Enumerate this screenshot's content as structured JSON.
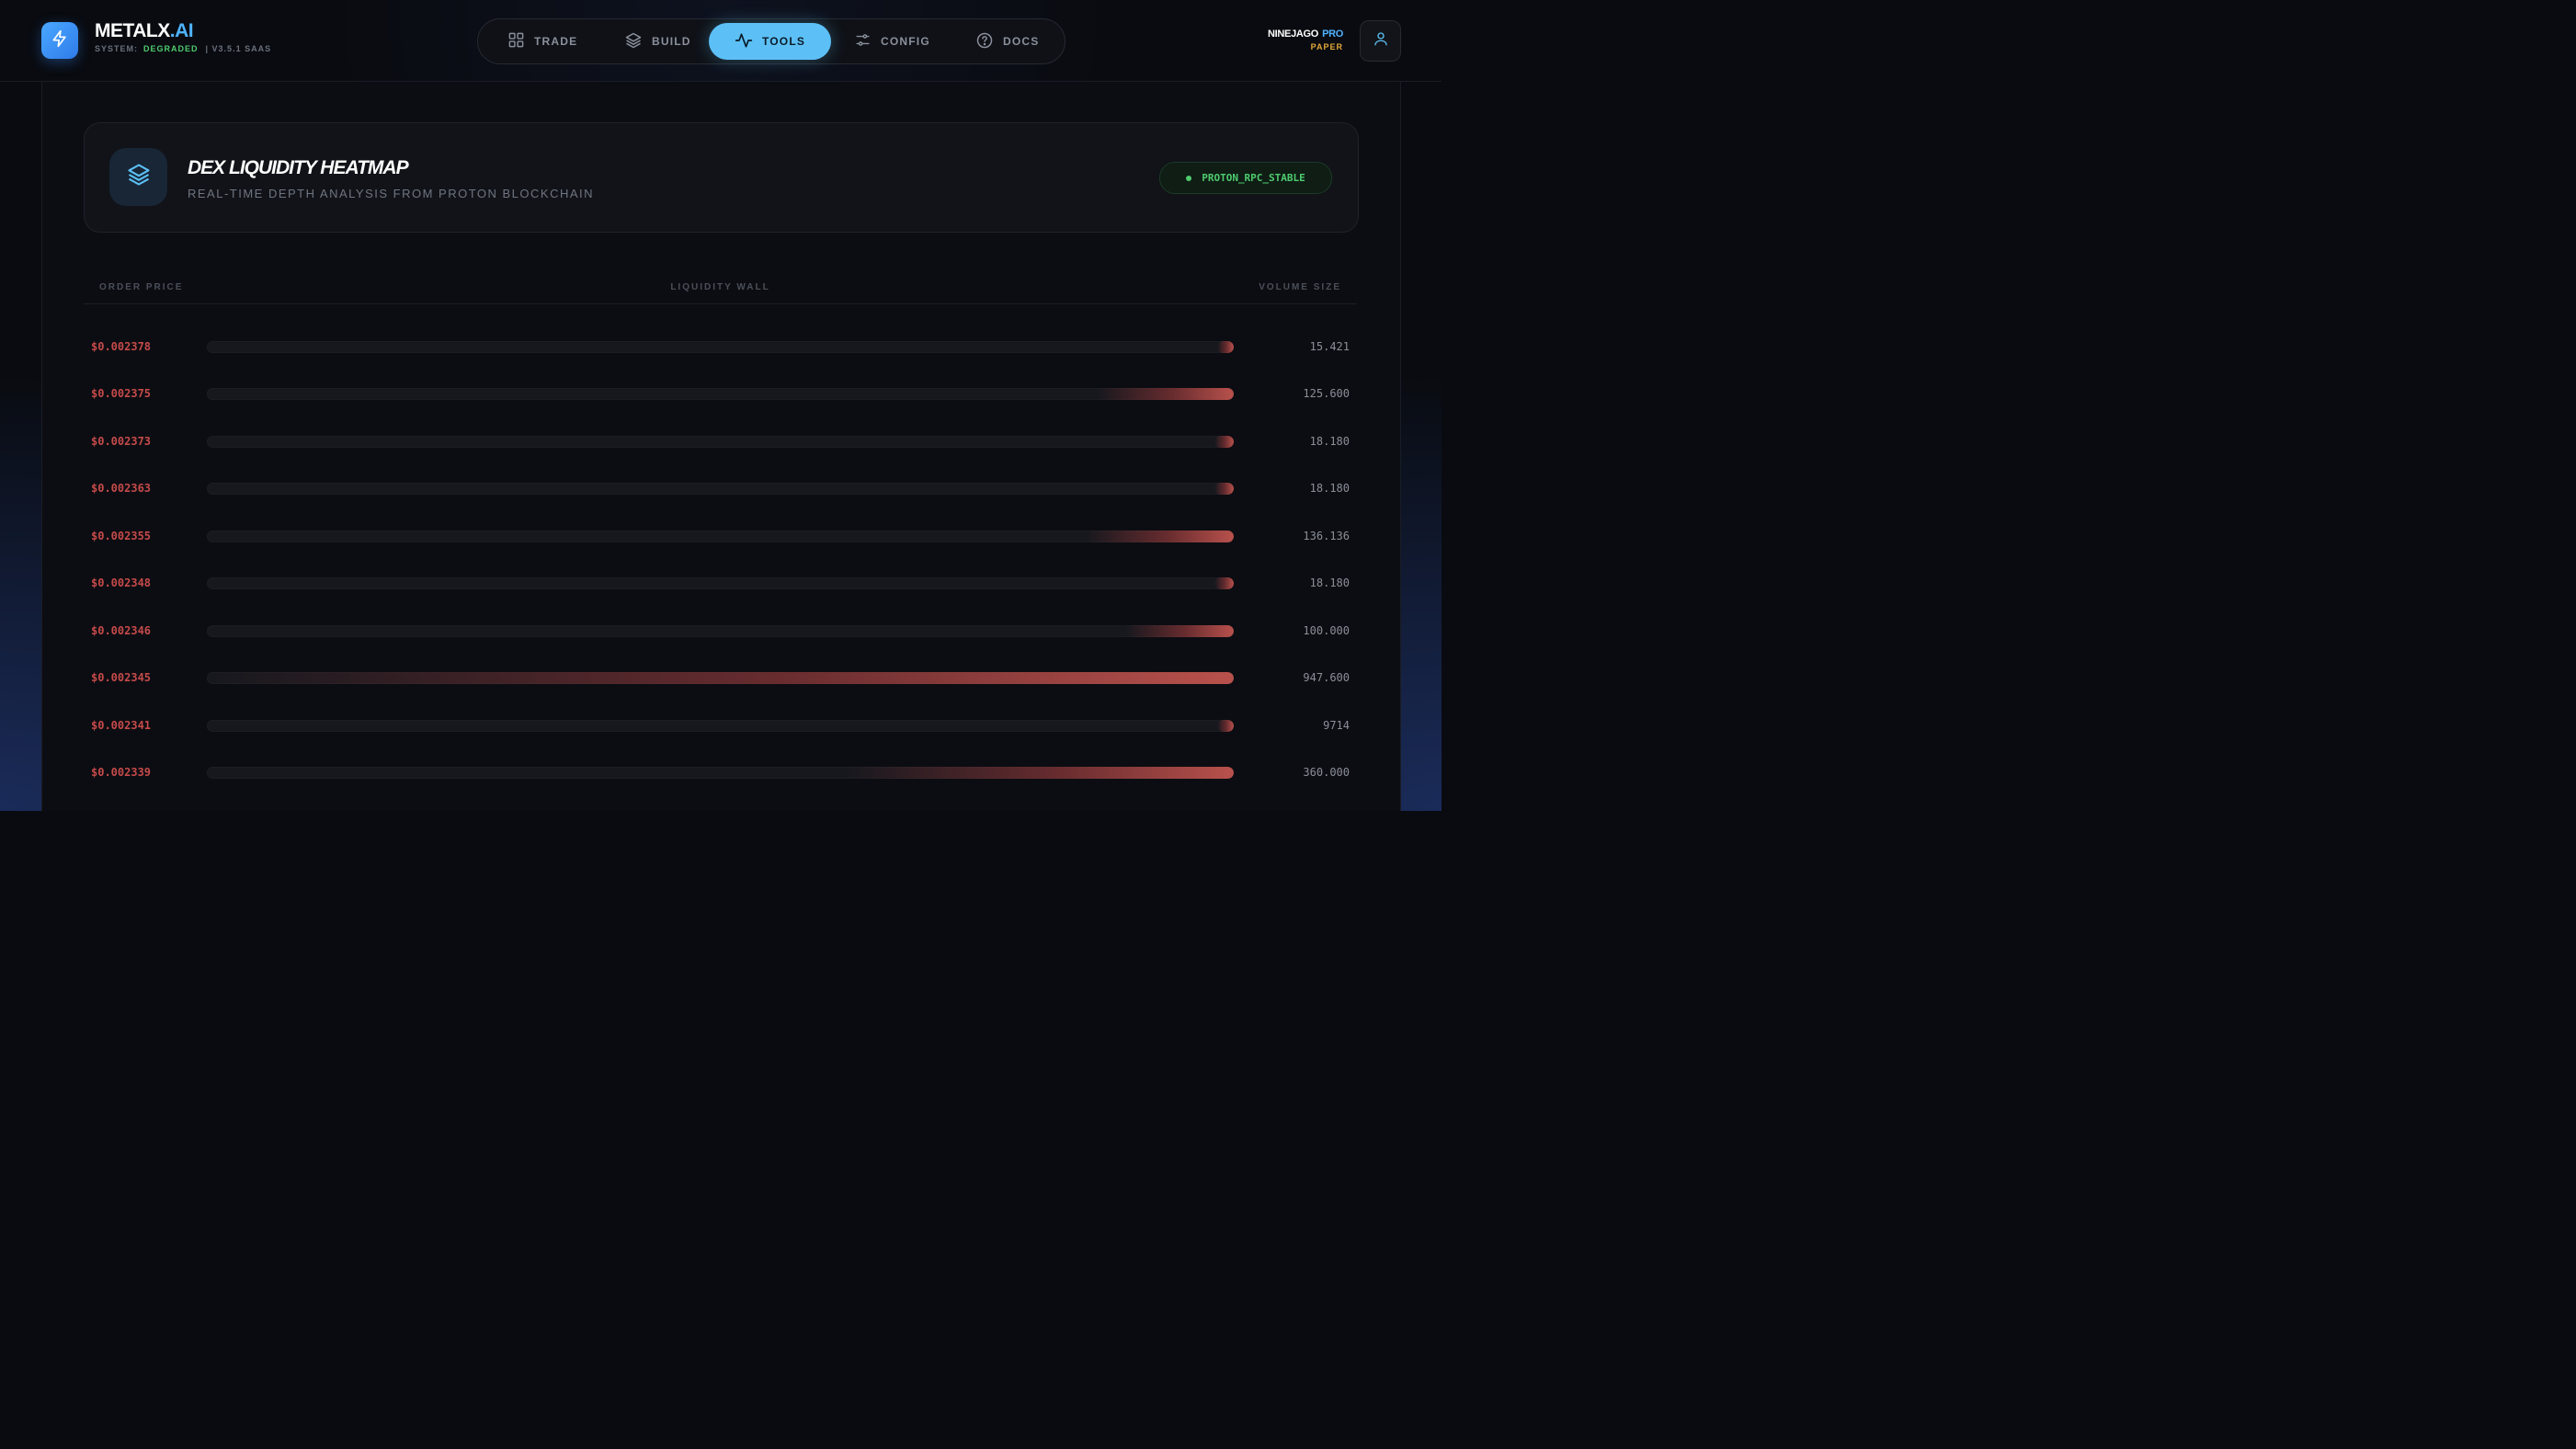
{
  "brand": {
    "name": "METALX",
    "suffix": ".AI",
    "system_label": "SYSTEM:",
    "system_status": "DEGRADED",
    "version": "| V3.5.1 SAAS"
  },
  "nav": {
    "tabs": [
      {
        "label": "TRADE",
        "icon": "grid-icon",
        "active": false
      },
      {
        "label": "BUILD",
        "icon": "layers-icon",
        "active": false
      },
      {
        "label": "TOOLS",
        "icon": "activity-icon",
        "active": true
      },
      {
        "label": "CONFIG",
        "icon": "sliders-icon",
        "active": false
      },
      {
        "label": "DOCS",
        "icon": "help-circle-icon",
        "active": false
      }
    ]
  },
  "user": {
    "name": "NINEJAGO",
    "tier": "PRO",
    "mode": "PAPER",
    "icon": "user-icon"
  },
  "card": {
    "icon": "layers-icon",
    "title": "DEX LIQUIDITY HEATMAP",
    "subtitle": "REAL-TIME DEPTH ANALYSIS FROM PROTON BLOCKCHAIN",
    "badge": "PROTON_RPC_STABLE"
  },
  "table": {
    "headers": {
      "price": "ORDER PRICE",
      "wall": "LIQUIDITY WALL",
      "volume": "VOLUME SIZE"
    },
    "rows": [
      {
        "price": "$0.002378",
        "volume": "15.421",
        "fill": 0.016
      },
      {
        "price": "$0.002375",
        "volume": "125.600",
        "fill": 0.133
      },
      {
        "price": "$0.002373",
        "volume": "18.180",
        "fill": 0.019
      },
      {
        "price": "$0.002363",
        "volume": "18.180",
        "fill": 0.019
      },
      {
        "price": "$0.002355",
        "volume": "136.136",
        "fill": 0.144
      },
      {
        "price": "$0.002348",
        "volume": "18.180",
        "fill": 0.019
      },
      {
        "price": "$0.002346",
        "volume": "100.000",
        "fill": 0.106
      },
      {
        "price": "$0.002345",
        "volume": "947.600",
        "fill": 1.0
      },
      {
        "price": "$0.002341",
        "volume": "9714",
        "fill": 0.01
      },
      {
        "price": "$0.002339",
        "volume": "360.000",
        "fill": 0.38
      }
    ]
  },
  "colors": {
    "accent": "#5cc0f6",
    "ask": "#c54a4a",
    "ok": "#4ecb6e",
    "warn": "#e3a93a"
  }
}
